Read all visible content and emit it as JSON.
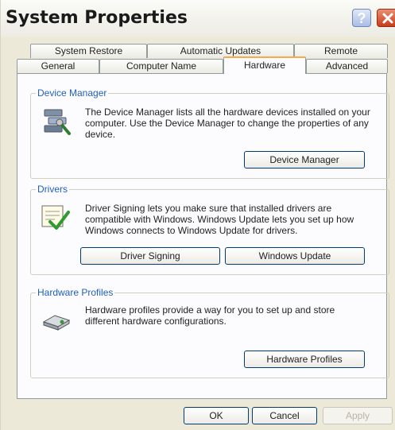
{
  "window": {
    "title": "System Properties",
    "help_symbol": "?"
  },
  "tabs": {
    "row1": [
      "System Restore",
      "Automatic Updates",
      "Remote"
    ],
    "row2": [
      "General",
      "Computer Name",
      "Hardware",
      "Advanced"
    ],
    "active": "Hardware"
  },
  "device_manager": {
    "label": "Device Manager",
    "description": "The Device Manager lists all the hardware devices installed on your computer. Use the Device Manager to change the properties of any device.",
    "button": "Device Manager",
    "icon": "device-manager-icon"
  },
  "drivers": {
    "label": "Drivers",
    "description": "Driver Signing lets you make sure that installed drivers are compatible with Windows. Windows Update lets you set up how Windows connects to Windows Update for drivers.",
    "button_signing": "Driver Signing",
    "button_update": "Windows Update",
    "icon": "driver-signing-icon"
  },
  "hardware_profiles": {
    "label": "Hardware Profiles",
    "description": "Hardware profiles provide a way for you to set up and store different hardware configurations.",
    "button": "Hardware Profiles",
    "icon": "hardware-profiles-icon"
  },
  "footer": {
    "ok": "OK",
    "cancel": "Cancel",
    "apply": "Apply"
  },
  "colors": {
    "group_label": "#1f5fbf",
    "active_tab_accent": "#f7a94b",
    "face": "#ECE9D8"
  }
}
